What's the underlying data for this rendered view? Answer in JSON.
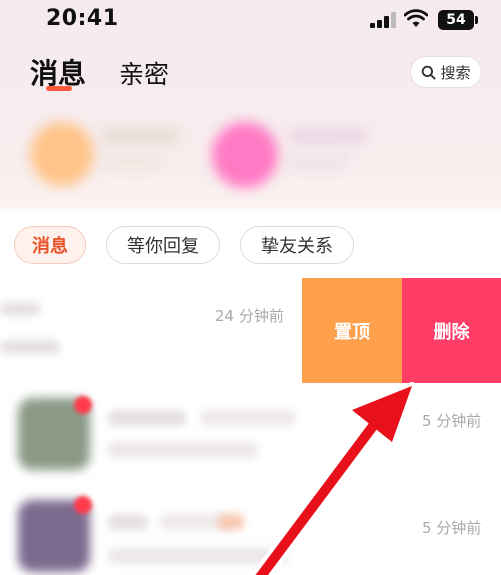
{
  "status": {
    "time": "20:41",
    "battery": "54"
  },
  "header": {
    "tabs": [
      {
        "label": "消息",
        "active": true
      },
      {
        "label": "亲密",
        "active": false
      }
    ],
    "search_label": "搜索"
  },
  "filters": [
    {
      "label": "消息",
      "active": true
    },
    {
      "label": "等你回复",
      "active": false
    },
    {
      "label": "挚友关系",
      "active": false
    }
  ],
  "list": [
    {
      "time": "24 分钟前",
      "swiped": true
    },
    {
      "time": "5 分钟前",
      "swiped": false
    },
    {
      "time": "5 分钟前",
      "swiped": false
    }
  ],
  "swipe_actions": {
    "pin_label": "置顶",
    "delete_label": "删除"
  },
  "colors": {
    "accent": "#ff5a3c",
    "pin": "#ffa04c",
    "delete": "#ff3d66",
    "annotation_arrow": "#e8101a"
  }
}
